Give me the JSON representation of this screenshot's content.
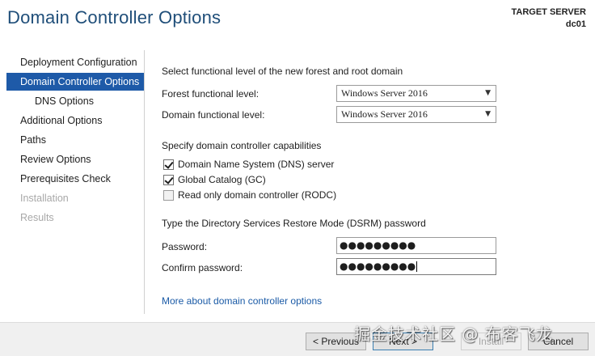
{
  "header": {
    "title": "Domain Controller Options",
    "target_label": "TARGET SERVER",
    "target_value": "dc01"
  },
  "nav": {
    "items": [
      {
        "label": "Deployment Configuration",
        "state": "normal"
      },
      {
        "label": "Domain Controller Options",
        "state": "selected"
      },
      {
        "label": "DNS Options",
        "state": "sub"
      },
      {
        "label": "Additional Options",
        "state": "normal"
      },
      {
        "label": "Paths",
        "state": "normal"
      },
      {
        "label": "Review Options",
        "state": "normal"
      },
      {
        "label": "Prerequisites Check",
        "state": "normal"
      },
      {
        "label": "Installation",
        "state": "disabled"
      },
      {
        "label": "Results",
        "state": "disabled"
      }
    ]
  },
  "content": {
    "functional_heading": "Select functional level of the new forest and root domain",
    "forest_label": "Forest functional level:",
    "forest_value": "Windows Server 2016",
    "domain_label": "Domain functional level:",
    "domain_value": "Windows Server 2016",
    "capabilities_heading": "Specify domain controller capabilities",
    "capabilities": [
      {
        "label": "Domain Name System (DNS) server",
        "checked": true
      },
      {
        "label": "Global Catalog (GC)",
        "checked": true
      },
      {
        "label": "Read only domain controller (RODC)",
        "checked": false
      }
    ],
    "dsrm_heading": "Type the Directory Services Restore Mode (DSRM) password",
    "password_label": "Password:",
    "password_value": "●●●●●●●●●",
    "confirm_label": "Confirm password:",
    "confirm_value": "●●●●●●●●●",
    "more_link": "More about domain controller options"
  },
  "footer": {
    "previous": "< Previous",
    "next": "Next >",
    "install": "Install",
    "cancel": "Cancel"
  },
  "watermark": "掘金技术社区 @ 布客飞龙",
  "colors": {
    "title": "#1f4e79",
    "selected_nav": "#1e5aa8",
    "link": "#1a5aa6"
  }
}
